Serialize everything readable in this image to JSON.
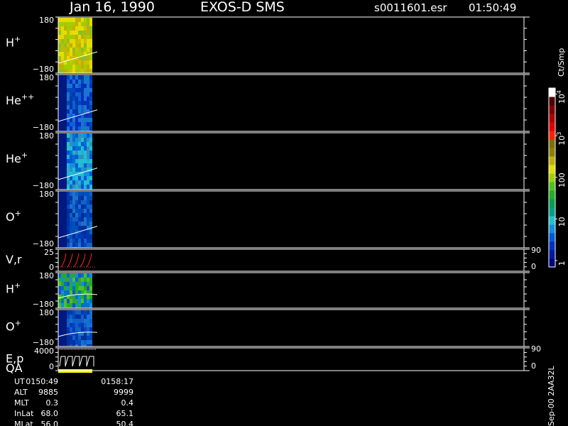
{
  "header": {
    "date": "Jan 16, 1990",
    "instrument": "EXOS-D SMS",
    "file": "s0011601.esr",
    "time": "01:50:49"
  },
  "colorbar": {
    "unit": "Ct/Smp",
    "ticks": [
      "1",
      "10",
      "100",
      "10",
      "10"
    ],
    "tick_exp": [
      "",
      "",
      "",
      "3",
      "4"
    ],
    "tick_values": [
      1,
      10,
      100,
      1000,
      10000
    ],
    "colors": [
      "#000080",
      "#0018a0",
      "#0030c0",
      "#0058d8",
      "#1090e0",
      "#20c0d0",
      "#00a080",
      "#00a050",
      "#20b020",
      "#50c020",
      "#a0d000",
      "#e0e000",
      "#c0b000",
      "#908000",
      "#807000",
      "#ff2000",
      "#e00000",
      "#b00000",
      "#800000",
      "#500000",
      "#ffffff"
    ]
  },
  "panels": [
    {
      "label": "H",
      "sup": "+",
      "ymax": "180",
      "ymin": "−180",
      "palette": "h",
      "rightLabels": []
    },
    {
      "label": "He",
      "sup": "++",
      "ymax": "180",
      "ymin": "−180",
      "palette": "he2",
      "rightLabels": []
    },
    {
      "label": "He",
      "sup": "+",
      "ymax": "180",
      "ymin": "−180",
      "palette": "he1",
      "rightLabels": []
    },
    {
      "label": "O",
      "sup": "+",
      "ymax": "180",
      "ymin": "−180",
      "palette": "o",
      "rightLabels": []
    },
    {
      "label": "V,r",
      "sup": "",
      "ymax": "25",
      "ymin": "0",
      "palette": "vr",
      "rightLabels": [
        "90",
        "0"
      ]
    },
    {
      "label": "H",
      "sup": "+",
      "ymax": "180",
      "ymin": "−180",
      "palette": "h2",
      "rightLabels": []
    },
    {
      "label": "O",
      "sup": "+",
      "ymax": "180",
      "ymin": "−180",
      "palette": "o2",
      "rightLabels": []
    },
    {
      "label": "E,p",
      "sup": "",
      "label2": "QA",
      "ymax": "4000",
      "ymin": "0",
      "palette": "ep",
      "rightLabels": [
        "90",
        "0"
      ]
    }
  ],
  "ephemeris": {
    "rows": [
      {
        "label": "UT",
        "v1": "0150:49",
        "v2": "0158:17"
      },
      {
        "label": "ALT",
        "v1": "9885",
        "v2": "9999"
      },
      {
        "label": "MLT",
        "v1": "0.3",
        "v2": "0.4"
      },
      {
        "label": "InLat",
        "v1": "68.0",
        "v2": "65.1"
      },
      {
        "label": "MLat",
        "v1": "56.0",
        "v2": "50.4"
      }
    ]
  },
  "footer": {
    "version": "Sep-00 2AA32L"
  }
}
